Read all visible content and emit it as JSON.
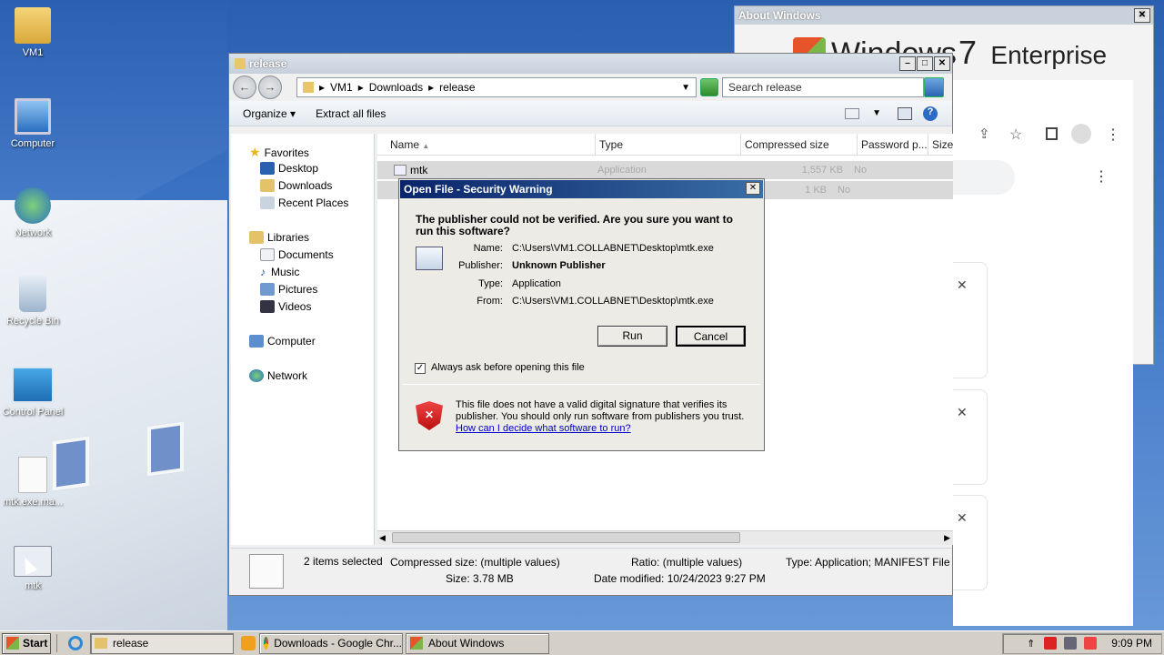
{
  "desktop": {
    "icons": [
      {
        "label": "VM1",
        "icon": "user-folder-icon"
      },
      {
        "label": "Computer",
        "icon": "computer-icon"
      },
      {
        "label": "Network",
        "icon": "network-icon"
      },
      {
        "label": "Recycle Bin",
        "icon": "recycle-bin-icon"
      },
      {
        "label": "Control Panel",
        "icon": "control-panel-icon"
      },
      {
        "label": "mtk.exe.ma...",
        "icon": "file-icon"
      },
      {
        "label": "mtk",
        "icon": "mtk-app-icon"
      }
    ]
  },
  "explorer": {
    "title": "release",
    "breadcrumb": [
      "VM1",
      "Downloads",
      "release"
    ],
    "search_placeholder": "Search release",
    "commands": {
      "organize": "Organize",
      "extract": "Extract all files"
    },
    "nav": {
      "favorites": "Favorites",
      "fav_items": [
        "Desktop",
        "Downloads",
        "Recent Places"
      ],
      "libraries": "Libraries",
      "lib_items": [
        "Documents",
        "Music",
        "Pictures",
        "Videos"
      ],
      "computer": "Computer",
      "network": "Network"
    },
    "columns": [
      "Name",
      "Type",
      "Compressed size",
      "Password p...",
      "Size"
    ],
    "files": [
      {
        "name": "mtk",
        "type": "Application",
        "compressed": "1,557 KB",
        "password": "No"
      },
      {
        "name": "",
        "type": "",
        "compressed": "1 KB",
        "password": "No"
      }
    ],
    "status": {
      "selected": "2 items selected",
      "compressed_label": "Compressed size:",
      "compressed_value": "(multiple values)",
      "ratio_label": "Ratio:",
      "ratio_value": "(multiple values)",
      "type_label": "Type:",
      "type_value": "Application; MANIFEST File",
      "size_label": "Size:",
      "size_value": "3.78 MB",
      "date_label": "Date modified:",
      "date_value": "10/24/2023 9:27 PM"
    }
  },
  "about": {
    "title": "About Windows",
    "brand": "Windows",
    "version": "7",
    "edition": "Enterprise"
  },
  "dialog": {
    "title": "Open File - Security Warning",
    "question": "The publisher could not be verified.  Are you sure you want to run this software?",
    "labels": {
      "name": "Name:",
      "publisher": "Publisher:",
      "type": "Type:",
      "from": "From:"
    },
    "values": {
      "name": "C:\\Users\\VM1.COLLABNET\\Desktop\\mtk.exe",
      "publisher": "Unknown Publisher",
      "type": "Application",
      "from": "C:\\Users\\VM1.COLLABNET\\Desktop\\mtk.exe"
    },
    "run": "Run",
    "cancel": "Cancel",
    "checkbox": "Always ask before opening this file",
    "warning": "This file does not have a valid digital signature that verifies its publisher.  You should only run software from publishers you trust.",
    "link": "How can I decide what software to run?"
  },
  "taskbar": {
    "start": "Start",
    "tasks": [
      "release",
      "Downloads - Google Chr...",
      "About Windows"
    ],
    "clock": "9:09 PM"
  }
}
